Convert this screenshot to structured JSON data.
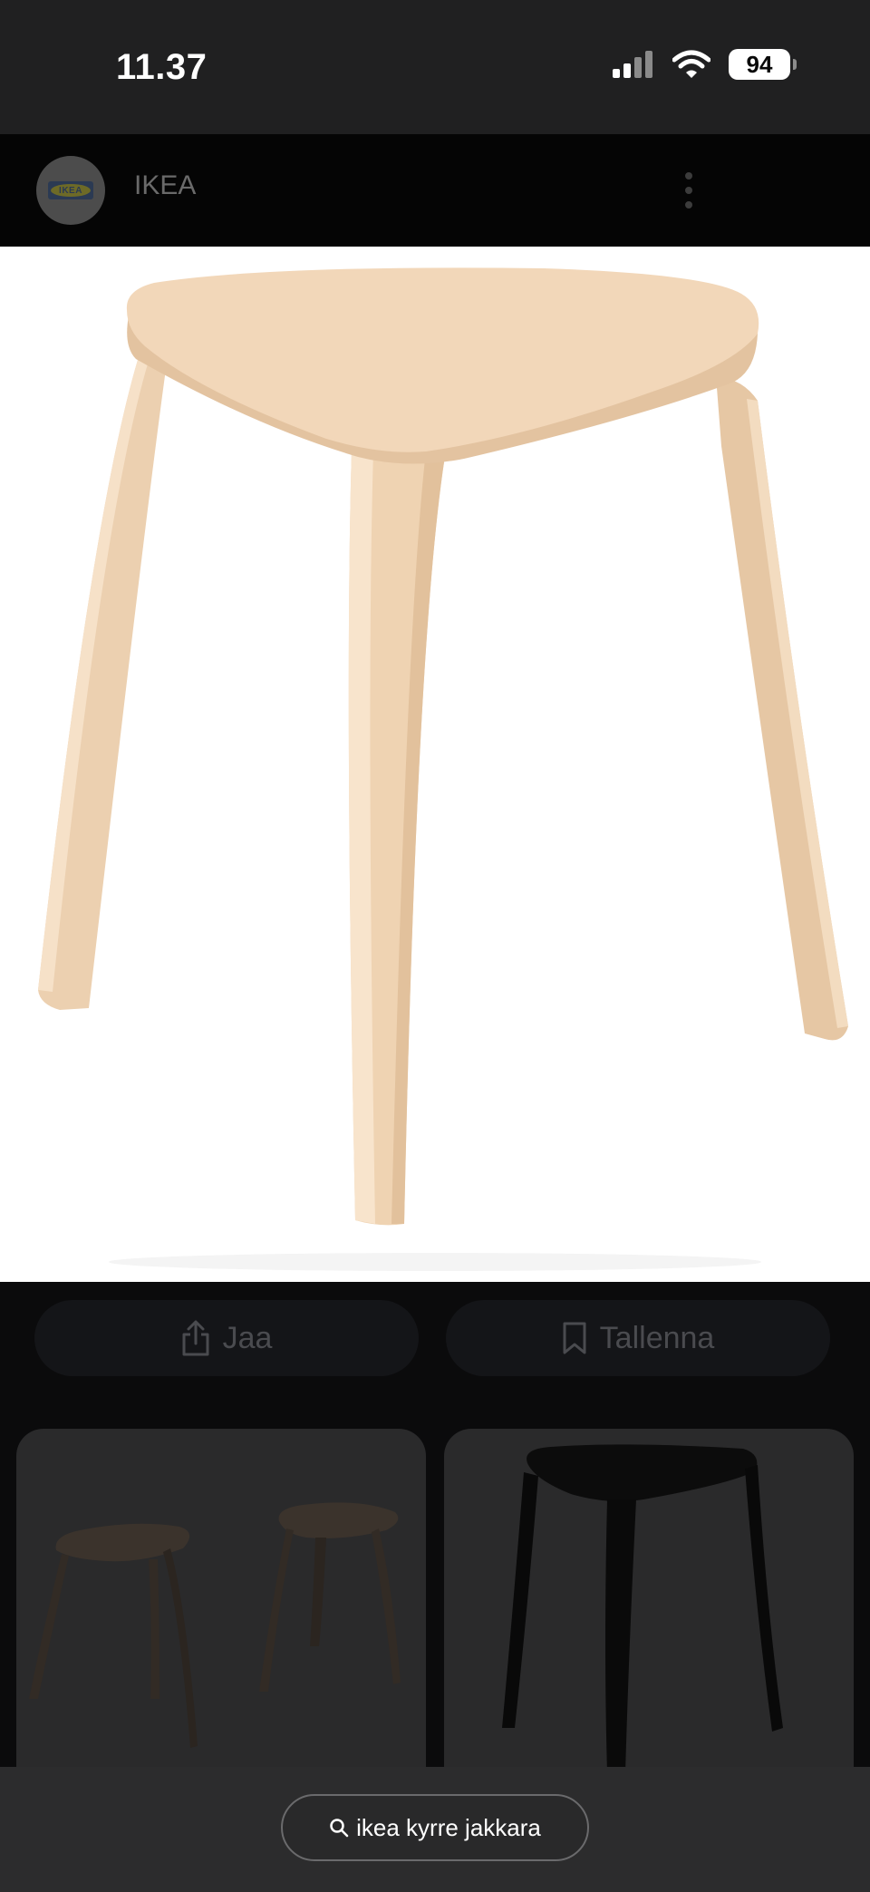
{
  "status_bar": {
    "time": "11.37",
    "battery": "94"
  },
  "header": {
    "app_name": "IKEA",
    "logo_text": "IKEA"
  },
  "actions": {
    "share_label": "Jaa",
    "save_label": "Tallenna"
  },
  "search": {
    "query": "ikea kyrre jakkara"
  },
  "colors": {
    "birch": "#f2d7b9",
    "black_stool": "#0c0c0c",
    "dimmed_stool": "#3b332c"
  }
}
